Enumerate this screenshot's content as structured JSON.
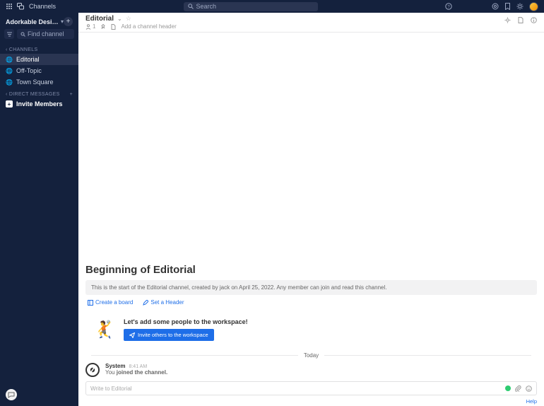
{
  "topbar": {
    "app_label": "Channels",
    "search_placeholder": "Search"
  },
  "sidebar": {
    "workspace_name": "Adorkable Desig...",
    "find_placeholder": "Find channel",
    "channels_label": "CHANNELS",
    "dm_label": "DIRECT MESSAGES",
    "invite_label": "Invite Members",
    "channels": [
      {
        "name": "Editorial",
        "active": true
      },
      {
        "name": "Off-Topic",
        "active": false
      },
      {
        "name": "Town Square",
        "active": false
      }
    ]
  },
  "channel_header": {
    "title": "Editorial",
    "members": "1",
    "add_header_placeholder": "Add a channel header"
  },
  "intro": {
    "beginning_title": "Beginning of Editorial",
    "description": "This is the start of the Editorial channel, created by jack on April 25, 2022. Any member can join and read this channel.",
    "create_board": "Create a board",
    "set_header": "Set a Header",
    "invite_prompt": "Let's add some people to the workspace!",
    "invite_button": "Invite others to the workspace"
  },
  "timeline": {
    "date_label": "Today",
    "system_user": "System",
    "system_time": "8:41 AM",
    "system_prefix": "You",
    "system_text": " joined the channel."
  },
  "composer": {
    "placeholder": "Write to Editorial"
  },
  "footer": {
    "help": "Help"
  }
}
